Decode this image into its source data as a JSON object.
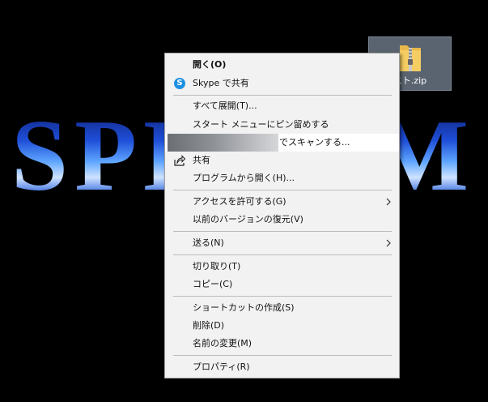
{
  "desktop": {
    "wallpaper_text": "SPEEDM",
    "file": {
      "label": "スト.zip",
      "icon": "zip-folder-icon"
    }
  },
  "context_menu": {
    "items": [
      {
        "label": "開く(O)",
        "bold": true
      },
      {
        "label": "Skype で共有",
        "icon": "skype-icon"
      },
      {
        "label": "すべて展開(T)..."
      },
      {
        "label": "スタート メニューにピン留めする"
      },
      {
        "label": "でスキャンする...",
        "highlighted": true
      },
      {
        "label": "共有",
        "icon": "share-icon"
      },
      {
        "label": "プログラムから開く(H)..."
      },
      {
        "label": "アクセスを許可する(G)",
        "submenu": true
      },
      {
        "label": "以前のバージョンの復元(V)"
      },
      {
        "label": "送る(N)",
        "submenu": true
      },
      {
        "label": "切り取り(T)"
      },
      {
        "label": "コピー(C)"
      },
      {
        "label": "ショートカットの作成(S)"
      },
      {
        "label": "削除(D)"
      },
      {
        "label": "名前の変更(M)"
      },
      {
        "label": "プロパティ(R)"
      }
    ]
  },
  "colors": {
    "menu_background": "#f2f2f2",
    "highlight": "#ffffff",
    "separator": "#bcbcbc",
    "skype_blue": "#1e90e0",
    "desktop_background": "#000000"
  }
}
